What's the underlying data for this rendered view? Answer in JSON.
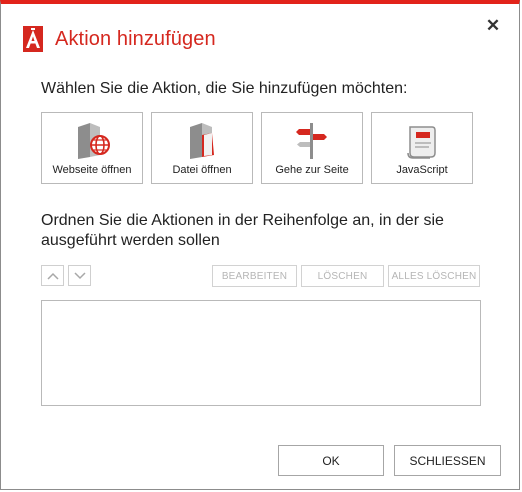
{
  "dialog": {
    "title": "Aktion hinzufügen",
    "accent_color": "#e2231a"
  },
  "choose_heading": "Wählen Sie die Aktion, die Sie hinzufügen möchten:",
  "action_types": [
    {
      "label": "Webseite öffnen",
      "icon": "webpage-globe-icon"
    },
    {
      "label": "Datei öffnen",
      "icon": "file-icon"
    },
    {
      "label": "Gehe zur Seite",
      "icon": "signpost-icon"
    },
    {
      "label": "JavaScript",
      "icon": "script-scroll-icon"
    }
  ],
  "order_heading": "Ordnen Sie die Aktionen in der Reihenfolge an, in der sie ausgeführt werden sollen",
  "list_toolbar": {
    "edit_label": "BEARBEITEN",
    "delete_label": "LÖSCHEN",
    "delete_all_label": "ALLES LÖSCHEN"
  },
  "actions_list": [],
  "footer": {
    "ok_label": "OK",
    "close_label": "SCHLIESSEN"
  }
}
